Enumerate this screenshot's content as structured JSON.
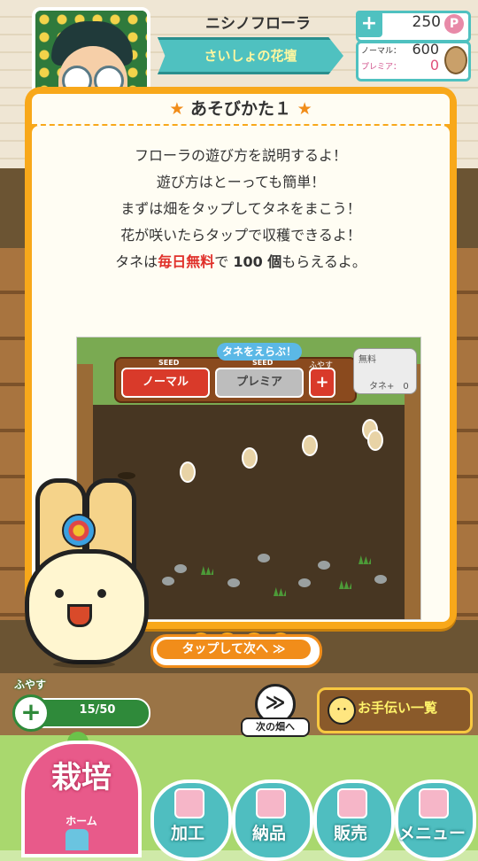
{
  "header": {
    "player_name": "ニシノフローラ",
    "title": "さいしょの花壇",
    "points_plus": "+",
    "points": "250",
    "points_unit": "P",
    "seeds": {
      "normal_label": "ノーマル：",
      "normal_count": "600",
      "premium_label": "プレミア：",
      "premium_count": "0"
    }
  },
  "dialog": {
    "title_star": "★",
    "title": "あそびかた１",
    "lines": [
      "フローラの遊び方を説明するよ！",
      "遊び方はとーっても簡単！",
      "まずは畑をタップしてタネをまこう！",
      "花が咲いたらタップで収穫できるよ！"
    ],
    "line5_prefix": "タネは",
    "line5_highlight": "毎日無料",
    "line5_mid": "で",
    "line5_count": "100 個",
    "line5_suffix": "もらえるよ。",
    "tutorial_image": {
      "caption": "タネをえらぶ！",
      "seed_tag": "SEED",
      "normal_button": "ノーマル",
      "premium_button": "プレミア",
      "expand_label": "ふやす",
      "plus": "+",
      "free_label": "無料",
      "free_count": "タネ+　0"
    },
    "page_dots": [
      true,
      false,
      false,
      false
    ]
  },
  "next_button": {
    "label": "タップして次へ ≫"
  },
  "field_controls": {
    "expand_label": "ふやす",
    "expand_plus": "+",
    "plot_count": "15/50",
    "next_field_icon": "≫",
    "next_field_label": "次の畑へ",
    "helper_icon": "･･",
    "helper_label": "お手伝い一覧"
  },
  "bottom_nav": {
    "home_title": "栽培",
    "home_sub": "ホーム",
    "items": [
      {
        "label": "加工",
        "icon": "bouquet-icon"
      },
      {
        "label": "納品",
        "icon": "gift-box-icon"
      },
      {
        "label": "販売",
        "icon": "cart-icon"
      },
      {
        "label": "メニュー",
        "icon": "building-icon"
      }
    ]
  },
  "colors": {
    "dialog_orange": "#f8a81a",
    "teal": "#4fc1c0",
    "pink": "#e85a8a",
    "green": "#2f8a3a"
  }
}
